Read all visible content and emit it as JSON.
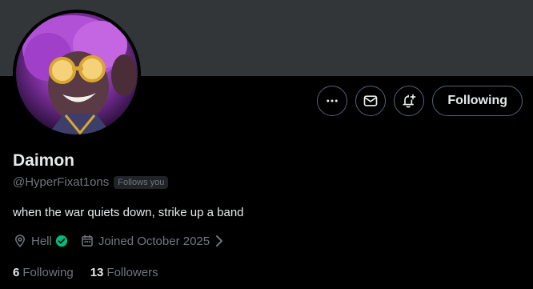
{
  "profile": {
    "name": "Daimon",
    "handle": "@HyperFixat1ons",
    "follows_you_badge": "Follows you",
    "bio": "when the war quiets down, strike up a band",
    "location": "Hell",
    "joined": "Joined October 2025"
  },
  "actions": {
    "following_label": "Following"
  },
  "stats": {
    "following_count": "6",
    "following_label": "Following",
    "followers_count": "13",
    "followers_label": "Followers"
  },
  "colors": {
    "background": "#000000",
    "banner": "#333639",
    "text_primary": "#e7e9ea",
    "text_secondary": "#71767b",
    "verified_badge": "#00ba7c",
    "avatar_accent": "#b04fd0"
  },
  "icons": {
    "more": "ellipsis-icon",
    "message": "mail-icon",
    "notify": "bell-plus-icon",
    "location": "location-pin-icon",
    "calendar": "calendar-icon",
    "verified": "verified-check-icon",
    "chevron": "chevron-right-icon"
  }
}
